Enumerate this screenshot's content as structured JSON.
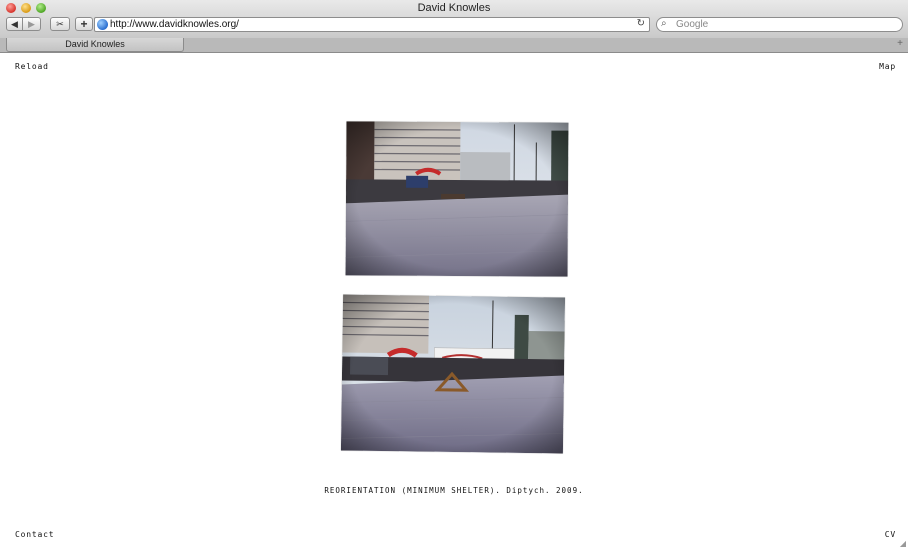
{
  "window": {
    "title": "David Knowles"
  },
  "toolbar": {
    "back_glyph": "◀",
    "forward_glyph": "▶",
    "snapshot_glyph": "✂",
    "add_glyph": "+",
    "url": "http://www.davidknowles.org/",
    "reload_glyph": "↻",
    "search_placeholder": "Google",
    "search_glyph": "⌕"
  },
  "tabs": [
    {
      "label": "David Knowles",
      "active": true
    }
  ],
  "new_tab_glyph": "+",
  "page": {
    "nav": {
      "top_left": "Reload",
      "top_right": "Map",
      "bottom_left": "Contact",
      "bottom_right": "CV"
    },
    "caption": "REORIENTATION (MINIMUM SHELTER). Diptych. 2009."
  },
  "colors": {
    "background": "#ffffff",
    "text": "#111111"
  }
}
